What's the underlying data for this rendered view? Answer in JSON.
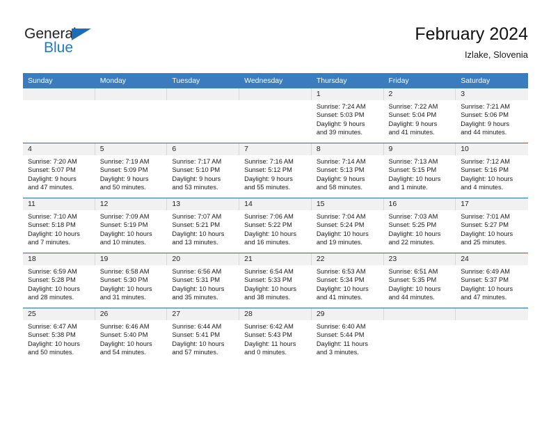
{
  "brand": {
    "name_dark": "General",
    "name_blue": "Blue",
    "triangle_icon": "brand-triangle-icon",
    "accent_color": "#1f7ac4"
  },
  "header": {
    "title": "February 2024",
    "location": "Izlake, Slovenia"
  },
  "colors": {
    "header_bar": "#3a7cbe",
    "row_divider": "#2a6ca8",
    "daynum_band": "#f1f1f1",
    "cell_divider": "#d8d8d8"
  },
  "weekday_headers": [
    "Sunday",
    "Monday",
    "Tuesday",
    "Wednesday",
    "Thursday",
    "Friday",
    "Saturday"
  ],
  "weeks": [
    [
      {
        "day": "",
        "empty": true,
        "sunrise": "",
        "sunset": "",
        "daylight_1": "",
        "daylight_2": ""
      },
      {
        "day": "",
        "empty": true,
        "sunrise": "",
        "sunset": "",
        "daylight_1": "",
        "daylight_2": ""
      },
      {
        "day": "",
        "empty": true,
        "sunrise": "",
        "sunset": "",
        "daylight_1": "",
        "daylight_2": ""
      },
      {
        "day": "",
        "empty": true,
        "sunrise": "",
        "sunset": "",
        "daylight_1": "",
        "daylight_2": ""
      },
      {
        "day": "1",
        "empty": false,
        "sunrise": "Sunrise: 7:24 AM",
        "sunset": "Sunset: 5:03 PM",
        "daylight_1": "Daylight: 9 hours",
        "daylight_2": "and 39 minutes."
      },
      {
        "day": "2",
        "empty": false,
        "sunrise": "Sunrise: 7:22 AM",
        "sunset": "Sunset: 5:04 PM",
        "daylight_1": "Daylight: 9 hours",
        "daylight_2": "and 41 minutes."
      },
      {
        "day": "3",
        "empty": false,
        "sunrise": "Sunrise: 7:21 AM",
        "sunset": "Sunset: 5:06 PM",
        "daylight_1": "Daylight: 9 hours",
        "daylight_2": "and 44 minutes."
      }
    ],
    [
      {
        "day": "4",
        "empty": false,
        "sunrise": "Sunrise: 7:20 AM",
        "sunset": "Sunset: 5:07 PM",
        "daylight_1": "Daylight: 9 hours",
        "daylight_2": "and 47 minutes."
      },
      {
        "day": "5",
        "empty": false,
        "sunrise": "Sunrise: 7:19 AM",
        "sunset": "Sunset: 5:09 PM",
        "daylight_1": "Daylight: 9 hours",
        "daylight_2": "and 50 minutes."
      },
      {
        "day": "6",
        "empty": false,
        "sunrise": "Sunrise: 7:17 AM",
        "sunset": "Sunset: 5:10 PM",
        "daylight_1": "Daylight: 9 hours",
        "daylight_2": "and 53 minutes."
      },
      {
        "day": "7",
        "empty": false,
        "sunrise": "Sunrise: 7:16 AM",
        "sunset": "Sunset: 5:12 PM",
        "daylight_1": "Daylight: 9 hours",
        "daylight_2": "and 55 minutes."
      },
      {
        "day": "8",
        "empty": false,
        "sunrise": "Sunrise: 7:14 AM",
        "sunset": "Sunset: 5:13 PM",
        "daylight_1": "Daylight: 9 hours",
        "daylight_2": "and 58 minutes."
      },
      {
        "day": "9",
        "empty": false,
        "sunrise": "Sunrise: 7:13 AM",
        "sunset": "Sunset: 5:15 PM",
        "daylight_1": "Daylight: 10 hours",
        "daylight_2": "and 1 minute."
      },
      {
        "day": "10",
        "empty": false,
        "sunrise": "Sunrise: 7:12 AM",
        "sunset": "Sunset: 5:16 PM",
        "daylight_1": "Daylight: 10 hours",
        "daylight_2": "and 4 minutes."
      }
    ],
    [
      {
        "day": "11",
        "empty": false,
        "sunrise": "Sunrise: 7:10 AM",
        "sunset": "Sunset: 5:18 PM",
        "daylight_1": "Daylight: 10 hours",
        "daylight_2": "and 7 minutes."
      },
      {
        "day": "12",
        "empty": false,
        "sunrise": "Sunrise: 7:09 AM",
        "sunset": "Sunset: 5:19 PM",
        "daylight_1": "Daylight: 10 hours",
        "daylight_2": "and 10 minutes."
      },
      {
        "day": "13",
        "empty": false,
        "sunrise": "Sunrise: 7:07 AM",
        "sunset": "Sunset: 5:21 PM",
        "daylight_1": "Daylight: 10 hours",
        "daylight_2": "and 13 minutes."
      },
      {
        "day": "14",
        "empty": false,
        "sunrise": "Sunrise: 7:06 AM",
        "sunset": "Sunset: 5:22 PM",
        "daylight_1": "Daylight: 10 hours",
        "daylight_2": "and 16 minutes."
      },
      {
        "day": "15",
        "empty": false,
        "sunrise": "Sunrise: 7:04 AM",
        "sunset": "Sunset: 5:24 PM",
        "daylight_1": "Daylight: 10 hours",
        "daylight_2": "and 19 minutes."
      },
      {
        "day": "16",
        "empty": false,
        "sunrise": "Sunrise: 7:03 AM",
        "sunset": "Sunset: 5:25 PM",
        "daylight_1": "Daylight: 10 hours",
        "daylight_2": "and 22 minutes."
      },
      {
        "day": "17",
        "empty": false,
        "sunrise": "Sunrise: 7:01 AM",
        "sunset": "Sunset: 5:27 PM",
        "daylight_1": "Daylight: 10 hours",
        "daylight_2": "and 25 minutes."
      }
    ],
    [
      {
        "day": "18",
        "empty": false,
        "sunrise": "Sunrise: 6:59 AM",
        "sunset": "Sunset: 5:28 PM",
        "daylight_1": "Daylight: 10 hours",
        "daylight_2": "and 28 minutes."
      },
      {
        "day": "19",
        "empty": false,
        "sunrise": "Sunrise: 6:58 AM",
        "sunset": "Sunset: 5:30 PM",
        "daylight_1": "Daylight: 10 hours",
        "daylight_2": "and 31 minutes."
      },
      {
        "day": "20",
        "empty": false,
        "sunrise": "Sunrise: 6:56 AM",
        "sunset": "Sunset: 5:31 PM",
        "daylight_1": "Daylight: 10 hours",
        "daylight_2": "and 35 minutes."
      },
      {
        "day": "21",
        "empty": false,
        "sunrise": "Sunrise: 6:54 AM",
        "sunset": "Sunset: 5:33 PM",
        "daylight_1": "Daylight: 10 hours",
        "daylight_2": "and 38 minutes."
      },
      {
        "day": "22",
        "empty": false,
        "sunrise": "Sunrise: 6:53 AM",
        "sunset": "Sunset: 5:34 PM",
        "daylight_1": "Daylight: 10 hours",
        "daylight_2": "and 41 minutes."
      },
      {
        "day": "23",
        "empty": false,
        "sunrise": "Sunrise: 6:51 AM",
        "sunset": "Sunset: 5:35 PM",
        "daylight_1": "Daylight: 10 hours",
        "daylight_2": "and 44 minutes."
      },
      {
        "day": "24",
        "empty": false,
        "sunrise": "Sunrise: 6:49 AM",
        "sunset": "Sunset: 5:37 PM",
        "daylight_1": "Daylight: 10 hours",
        "daylight_2": "and 47 minutes."
      }
    ],
    [
      {
        "day": "25",
        "empty": false,
        "sunrise": "Sunrise: 6:47 AM",
        "sunset": "Sunset: 5:38 PM",
        "daylight_1": "Daylight: 10 hours",
        "daylight_2": "and 50 minutes."
      },
      {
        "day": "26",
        "empty": false,
        "sunrise": "Sunrise: 6:46 AM",
        "sunset": "Sunset: 5:40 PM",
        "daylight_1": "Daylight: 10 hours",
        "daylight_2": "and 54 minutes."
      },
      {
        "day": "27",
        "empty": false,
        "sunrise": "Sunrise: 6:44 AM",
        "sunset": "Sunset: 5:41 PM",
        "daylight_1": "Daylight: 10 hours",
        "daylight_2": "and 57 minutes."
      },
      {
        "day": "28",
        "empty": false,
        "sunrise": "Sunrise: 6:42 AM",
        "sunset": "Sunset: 5:43 PM",
        "daylight_1": "Daylight: 11 hours",
        "daylight_2": "and 0 minutes."
      },
      {
        "day": "29",
        "empty": false,
        "sunrise": "Sunrise: 6:40 AM",
        "sunset": "Sunset: 5:44 PM",
        "daylight_1": "Daylight: 11 hours",
        "daylight_2": "and 3 minutes."
      },
      {
        "day": "",
        "empty": true,
        "sunrise": "",
        "sunset": "",
        "daylight_1": "",
        "daylight_2": ""
      },
      {
        "day": "",
        "empty": true,
        "sunrise": "",
        "sunset": "",
        "daylight_1": "",
        "daylight_2": ""
      }
    ]
  ]
}
